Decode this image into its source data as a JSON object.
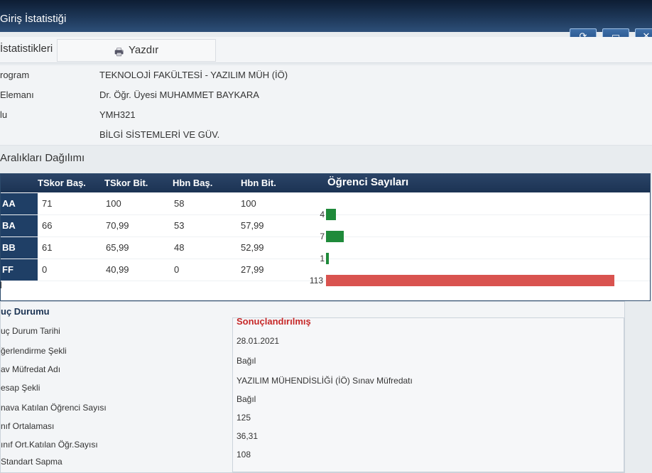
{
  "window": {
    "title": "Giriş İstatistiği"
  },
  "toolbar": {
    "section_title": "İstatistikleri",
    "print_label": "Yazdır",
    "print_icon": "printer-icon"
  },
  "window_controls": {
    "refresh_icon": "refresh-icon",
    "maximize_icon": "maximize-icon",
    "close_icon": "close-icon"
  },
  "info": {
    "rows": [
      {
        "label": "rogram",
        "value": "TEKNOLOJİ FAKÜLTESİ - YAZILIM MÜH (İÖ)"
      },
      {
        "label": "Elemanı",
        "value": "Dr. Öğr. Üyesi MUHAMMET BAYKARA"
      },
      {
        "label": "lu",
        "value": "YMH321"
      },
      {
        "label": "",
        "value": "BİLGİ SİSTEMLERİ VE GÜV."
      }
    ]
  },
  "distribution": {
    "section_title": "Aralıkları Dağılımı",
    "headers": {
      "tskor_bas": "TSkor Baş.",
      "tskor_bit": "TSkor Bit.",
      "hbn_bas": "Hbn Baş.",
      "hbn_bit": "Hbn Bit.",
      "ogrenci": "Öğrenci Sayıları"
    },
    "rows": [
      {
        "code": "AA",
        "tskor_bas": "71",
        "tskor_bit": "100",
        "hbn_bas": "58",
        "hbn_bit": "100",
        "count": "4"
      },
      {
        "code": "BA",
        "tskor_bas": "66",
        "tskor_bit": "70,99",
        "hbn_bas": "53",
        "hbn_bit": "57,99",
        "count": "7"
      },
      {
        "code": "BB",
        "tskor_bas": "61",
        "tskor_bit": "65,99",
        "hbn_bas": "48",
        "hbn_bit": "52,99",
        "count": "1"
      },
      {
        "code": "FF",
        "tskor_bas": "0",
        "tskor_bit": "40,99",
        "hbn_bas": "0",
        "hbn_bit": "27,99",
        "count": "113"
      }
    ],
    "total_mark": "l",
    "colors": {
      "pass": "#1f8a3a",
      "fail": "#d9534f"
    }
  },
  "status": {
    "title": "uç Durumu",
    "items": [
      {
        "label": "uç Durum Tarihi",
        "value": "Sonuçlandırılmış"
      },
      {
        "label": "ğerlendirme Şekli",
        "value": "28.01.2021"
      },
      {
        "label": "av Müfredat Adı",
        "value": "Bağıl"
      },
      {
        "label": "esap Şekli",
        "value": "YAZILIM MÜHENDİSLİĞİ (İÖ) Sınav Müfredatı"
      },
      {
        "label": "nava Katılan Öğrenci Sayısı",
        "value": "Bağıl"
      },
      {
        "label": "nıf Ortalaması",
        "value": "125"
      },
      {
        "label": "ınıf Ort.Katılan Öğr.Sayısı",
        "value": "36,31"
      },
      {
        "label": "Standart Sapma",
        "value": "108"
      }
    ]
  }
}
